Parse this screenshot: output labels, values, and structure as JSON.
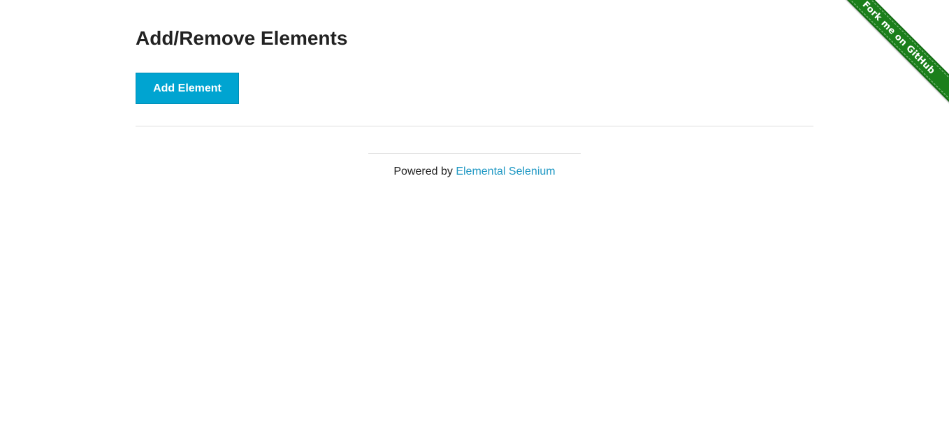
{
  "ribbon": {
    "label": "Fork me on GitHub",
    "color": "#1b7f1b"
  },
  "main": {
    "title": "Add/Remove Elements",
    "add_button_label": "Add Element",
    "button_color": "#00a4d1"
  },
  "footer": {
    "prefix": "Powered by",
    "link_label": "Elemental Selenium",
    "link_color": "#2199c4"
  }
}
